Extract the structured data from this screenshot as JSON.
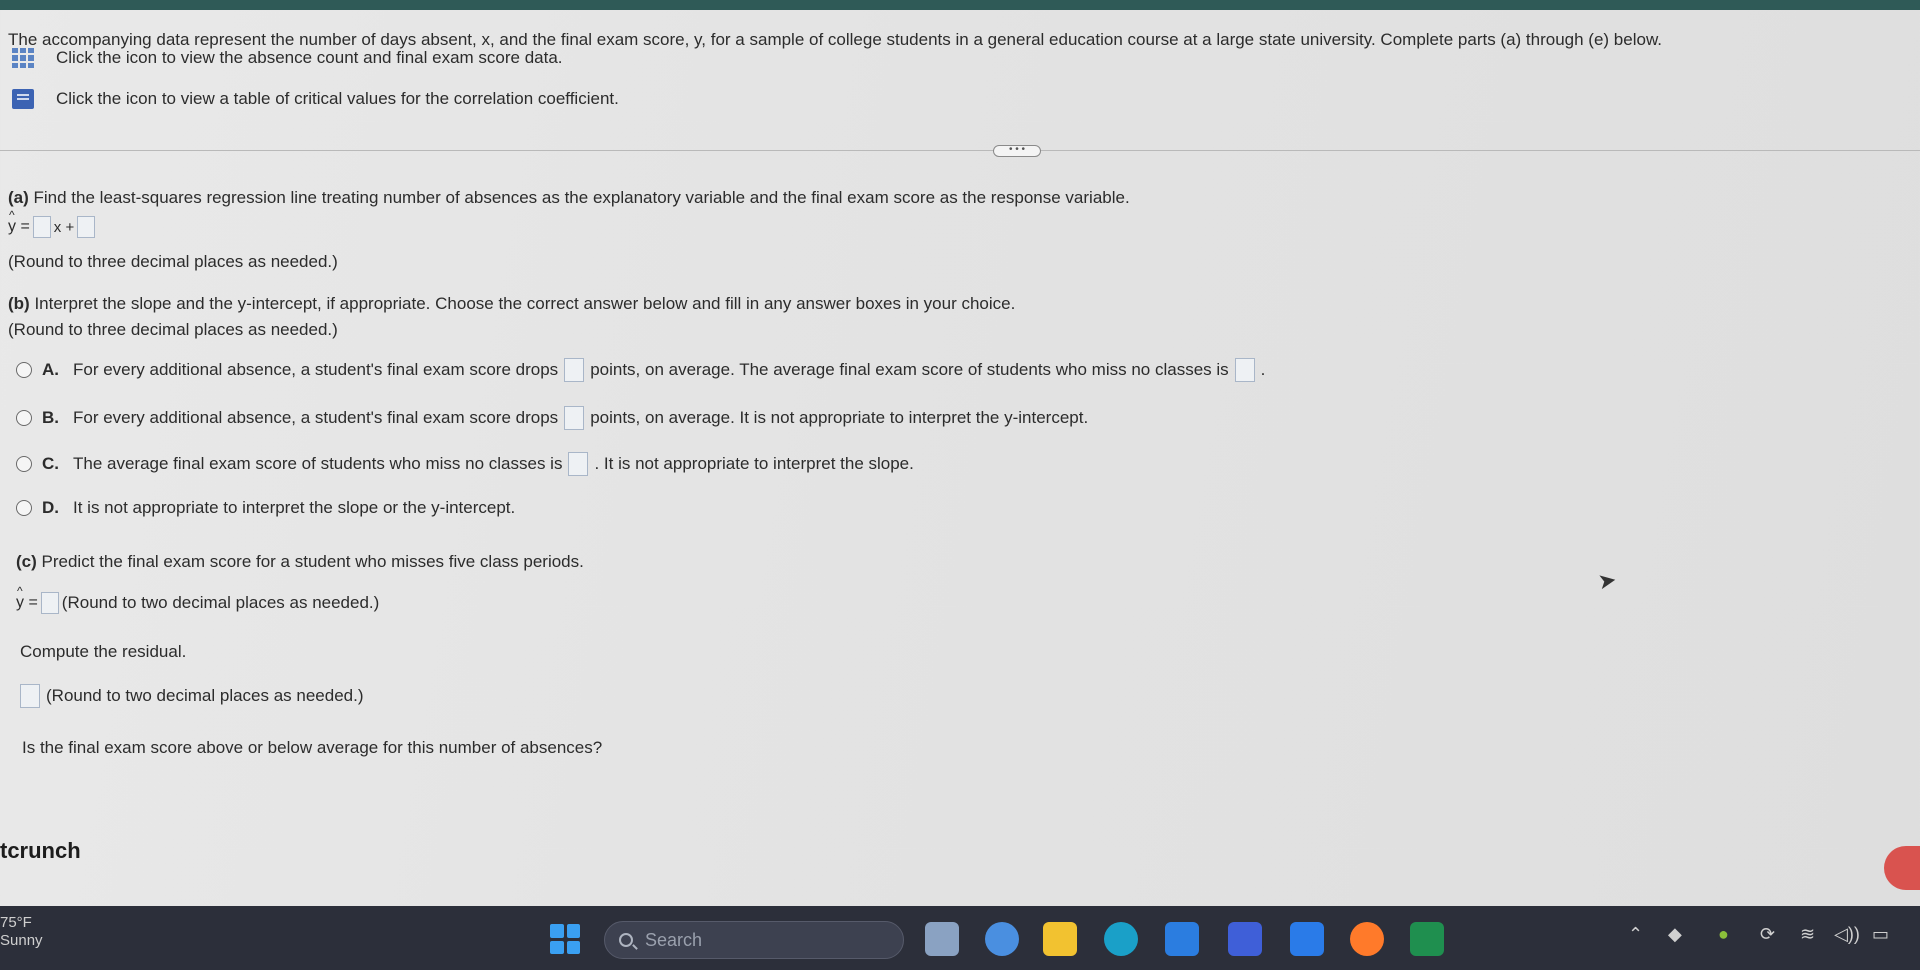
{
  "intro": {
    "text": "The accompanying data represent the number of days absent, x, and the final exam score, y, for a sample of college students in a general education course at a large state university. Complete parts (a) through (e) below.",
    "link1": "Click the icon to view the absence count and final exam score data.",
    "link2": "Click the icon to view a table of critical values for the correlation coefficient."
  },
  "divider_handle": "• • •",
  "part_a": {
    "label": "(a)",
    "prompt": "Find the least-squares regression line treating number of absences as the explanatory variable and the final exam score as the response variable.",
    "eq_lhs": "y =",
    "eq_mid": "x +",
    "round_note": "(Round to three decimal places as needed.)"
  },
  "part_b": {
    "label": "(b)",
    "prompt": "Interpret the slope and the y-intercept, if appropriate. Choose the correct answer below and fill in any answer boxes in your choice.",
    "round_note": "(Round to three decimal places as needed.)",
    "options": [
      {
        "letter": "A.",
        "t1": "For every additional absence, a student's final exam score drops",
        "t2": "points, on average. The average final exam score of students who miss no classes is",
        "t3": "."
      },
      {
        "letter": "B.",
        "t1": "For every additional absence, a student's final exam score drops",
        "t2": "points, on average. It is not appropriate to interpret the y-intercept."
      },
      {
        "letter": "C.",
        "t1": "The average final exam score of students who miss no classes is",
        "t2": ". It is not appropriate to interpret the slope."
      },
      {
        "letter": "D.",
        "t1": "It is not appropriate to interpret the slope or the y-intercept."
      }
    ]
  },
  "part_c": {
    "label": "(c)",
    "prompt": "Predict the final exam score for a student who misses five class periods.",
    "eq_lhs": "y =",
    "round_note": "(Round to two decimal places as needed.)",
    "residual_prompt": "Compute the residual.",
    "residual_note": "(Round to two decimal places as needed.)",
    "question": "Is the final exam score above or below average for this number of absences?"
  },
  "brand": "tcrunch",
  "taskbar": {
    "temp": "75°F",
    "condition": "Sunny",
    "search_placeholder": "Search"
  },
  "colors": {
    "topbar": "#2f5a57",
    "taskbar": "#2c2f3a",
    "icon_blue": "#3c63b3"
  }
}
